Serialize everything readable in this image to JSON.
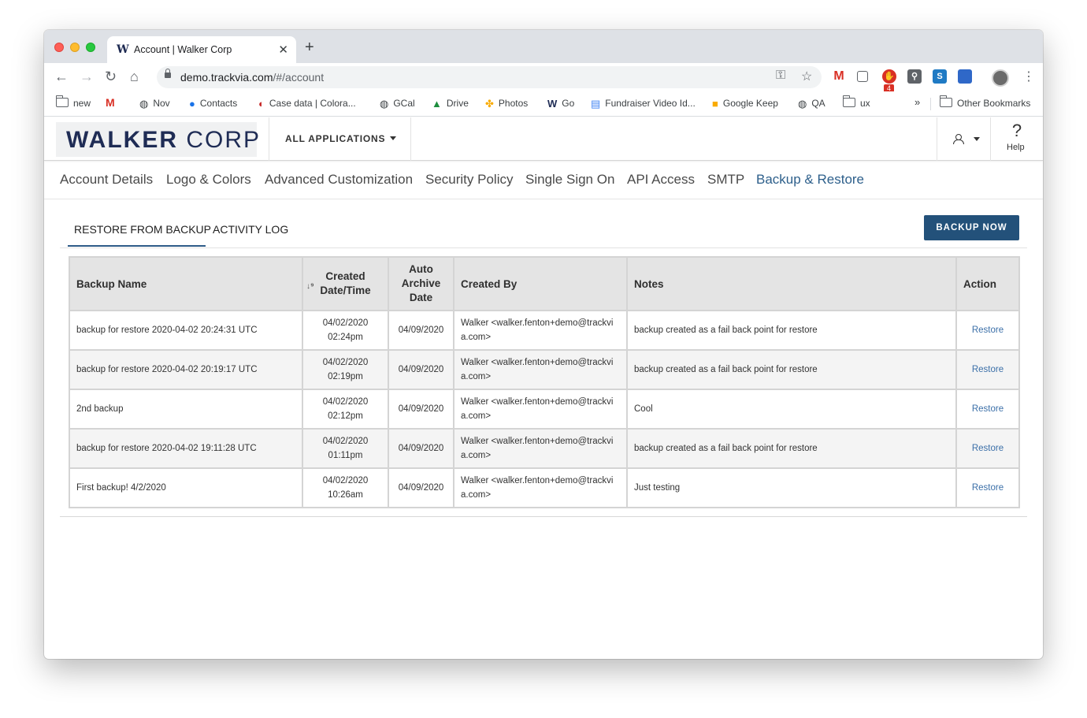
{
  "browser": {
    "tab_title": "Account | Walker Corp",
    "tab_favicon": "W",
    "tab_close": "✕",
    "new_tab": "+",
    "url_host": "demo.trackvia.com",
    "url_path": "/#/account",
    "gmail_badge": "4",
    "bookmarks": [
      {
        "label": "new",
        "icon": "folder-icon"
      },
      {
        "label": "",
        "icon": "gmail-icon"
      },
      {
        "label": "Nov",
        "icon": "globe-icon"
      },
      {
        "label": "Contacts",
        "icon": "contacts-icon"
      },
      {
        "label": "Case data | Colora...",
        "icon": "colorado-icon"
      },
      {
        "label": "GCal",
        "icon": "globe-icon"
      },
      {
        "label": "Drive",
        "icon": "drive-icon"
      },
      {
        "label": "Photos",
        "icon": "photos-icon"
      },
      {
        "label": "Go",
        "icon": "w-icon"
      },
      {
        "label": "Fundraiser Video Id...",
        "icon": "docs-icon"
      },
      {
        "label": "Google Keep",
        "icon": "keep-icon"
      },
      {
        "label": "QA",
        "icon": "globe-icon"
      },
      {
        "label": "ux",
        "icon": "folder-icon"
      }
    ],
    "bookmarks_overflow": "»",
    "other_bookmarks": "Other Bookmarks"
  },
  "header": {
    "logo_bold": "WALKER",
    "logo_light": "CORP",
    "all_applications": "ALL APPLICATIONS",
    "help": "Help",
    "help_glyph": "?"
  },
  "settings_nav": [
    {
      "label": "Account Details",
      "active": false
    },
    {
      "label": "Logo & Colors",
      "active": false
    },
    {
      "label": "Advanced Customization",
      "active": false
    },
    {
      "label": "Security Policy",
      "active": false
    },
    {
      "label": "Single Sign On",
      "active": false
    },
    {
      "label": "API Access",
      "active": false
    },
    {
      "label": "SMTP",
      "active": false
    },
    {
      "label": "Backup & Restore",
      "active": true
    }
  ],
  "subtabs": {
    "restore": "RESTORE FROM BACKUP",
    "activity": "ACTIVITY LOG",
    "active": "restore"
  },
  "backup_button": "BACKUP NOW",
  "table": {
    "headers": {
      "name": "Backup Name",
      "created_1": "Created",
      "created_2": "Date/Time",
      "archive_1": "Auto",
      "archive_2": "Archive",
      "archive_3": "Date",
      "created_by": "Created By",
      "notes": "Notes",
      "action": "Action"
    },
    "rows": [
      {
        "name": "backup for restore 2020-04-02 20:24:31 UTC",
        "date": "04/02/2020",
        "time": "02:24pm",
        "archive": "04/09/2020",
        "by_1": "Walker <walker.fenton+demo@trackvi",
        "by_2": "a.com>",
        "notes": "backup created as a fail back point for restore",
        "action": "Restore"
      },
      {
        "name": "backup for restore 2020-04-02 20:19:17 UTC",
        "date": "04/02/2020",
        "time": "02:19pm",
        "archive": "04/09/2020",
        "by_1": "Walker <walker.fenton+demo@trackvi",
        "by_2": "a.com>",
        "notes": "backup created as a fail back point for restore",
        "action": "Restore"
      },
      {
        "name": "2nd backup",
        "date": "04/02/2020",
        "time": "02:12pm",
        "archive": "04/09/2020",
        "by_1": "Walker <walker.fenton+demo@trackvi",
        "by_2": "a.com>",
        "notes": "Cool",
        "action": "Restore"
      },
      {
        "name": "backup for restore 2020-04-02 19:11:28 UTC",
        "date": "04/02/2020",
        "time": "01:11pm",
        "archive": "04/09/2020",
        "by_1": "Walker <walker.fenton+demo@trackvi",
        "by_2": "a.com>",
        "notes": "backup created as a fail back point for restore",
        "action": "Restore"
      },
      {
        "name": "First backup! 4/2/2020",
        "date": "04/02/2020",
        "time": "10:26am",
        "archive": "04/09/2020",
        "by_1": "Walker <walker.fenton+demo@trackvi",
        "by_2": "a.com>",
        "notes": "Just testing",
        "action": "Restore"
      }
    ]
  },
  "colors": {
    "accent": "#23517a",
    "active_nav": "#2d5f8b",
    "link": "#3b6fa8"
  }
}
